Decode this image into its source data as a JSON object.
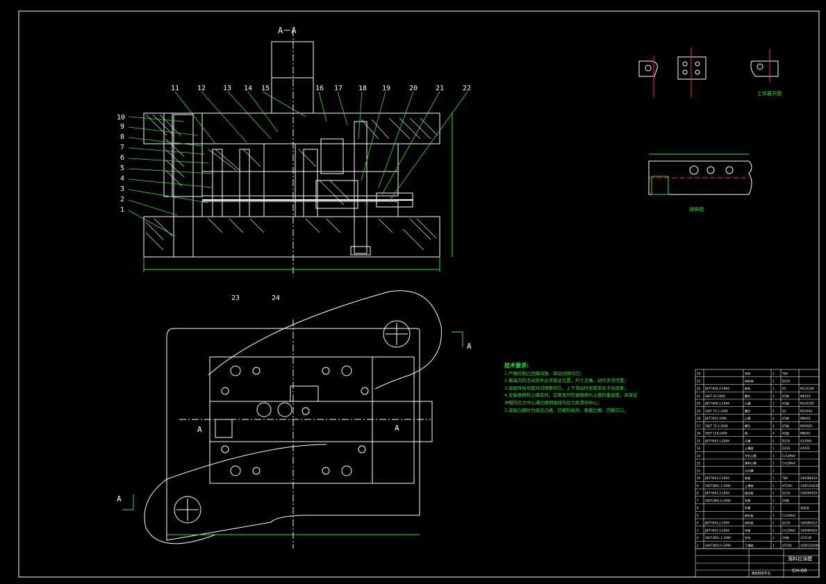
{
  "colors": {
    "background": "#000000",
    "outline": "#ffffff",
    "annotation": "#2ee82e",
    "dimension": "#2ee82e",
    "center_line": "#ff3030"
  },
  "section_label": "A－A",
  "section_marks": [
    "A",
    "A",
    "A",
    "A"
  ],
  "part_callouts": [
    "1",
    "2",
    "3",
    "4",
    "5",
    "6",
    "7",
    "8",
    "9",
    "10",
    "11",
    "12",
    "13",
    "14",
    "15",
    "16",
    "17",
    "18",
    "19",
    "20",
    "21",
    "22",
    "23",
    "24"
  ],
  "views": {
    "workpiece": "工件展开图",
    "strip_layout": "排样图"
  },
  "tech_requirements": {
    "title": "技术要求:",
    "items": [
      "1.严格控制凸凹模间隙，保证间隙均匀；",
      "2.模具内的活动部件必须保证位置，尺寸正确，动作灵活可靠；",
      "3.装配导柱导套时间隙要均匀，上下滑动时无阻滞及卡住现象；",
      "4.安装模柄和上模座时，应用角尺检查模柄与上模的垂直度，并保证",
      "  冲模的压力中心通过模柄轴线与压力机滑块中心；",
      "5.装配凸模时为保证凸模、凹模的粘剂，要磨凸模、凹模刃口。"
    ]
  },
  "bom": {
    "rows": [
      {
        "no": "24",
        "code": "",
        "name": "导料",
        "qty": "2",
        "mat": "T8A",
        "note": ""
      },
      {
        "no": "23",
        "code": "",
        "name": "挡料销",
        "qty": "1",
        "mat": "Q235",
        "note": ""
      },
      {
        "no": "22",
        "code": "JB/T7646.2-1994",
        "name": "卸料",
        "qty": "1",
        "mat": "45",
        "note": "M12X100"
      },
      {
        "no": "21",
        "code": "GB/T 65-2000",
        "name": "螺钉",
        "qty": "2",
        "mat": "45钢",
        "note": "M6X10"
      },
      {
        "no": "20",
        "code": "JB/T7646.5-1994",
        "name": "凸模",
        "qty": "1",
        "mat": "45钢",
        "note": "M10X100"
      },
      {
        "no": "19",
        "code": "GB/T 70.1-2000",
        "name": "螺钉",
        "qty": "4",
        "mat": "45",
        "note": "M10X45"
      },
      {
        "no": "18",
        "code": "JB/T7652-1994",
        "name": "凸模",
        "qty": "4",
        "mat": "45钢",
        "note": "M8X45"
      },
      {
        "no": "17",
        "code": "GB/T 70.1-2000",
        "name": "螺钉",
        "qty": "4",
        "mat": "45钢",
        "note": "M10X45"
      },
      {
        "no": "16",
        "code": "GB/T 119-2000",
        "name": "销",
        "qty": "4",
        "mat": "45钢",
        "note": "M8X45"
      },
      {
        "no": "15",
        "code": "JB/T7643.1-1994",
        "name": "凸模",
        "qty": "2",
        "mat": "Q235",
        "note": "A10X60"
      },
      {
        "no": "14",
        "code": "",
        "name": "上模座",
        "qty": "1",
        "mat": "Q235",
        "note": "40X20"
      },
      {
        "no": "13",
        "code": "",
        "name": "冲孔凸模",
        "qty": "3",
        "mat": "Cr12MoV",
        "note": ""
      },
      {
        "no": "12",
        "code": "",
        "name": "落料凸模",
        "qty": "1",
        "mat": "Cr12MoV",
        "note": ""
      },
      {
        "no": "11",
        "code": "",
        "name": "凸凹模",
        "qty": "1",
        "mat": "",
        "note": ""
      },
      {
        "no": "10",
        "code": "JB/T7643.2-1994",
        "name": "垫板",
        "qty": "1",
        "mat": "T8A",
        "note": "140X80X10"
      },
      {
        "no": "9",
        "code": "GB/T2861.1-1990",
        "name": "上模座",
        "qty": "1",
        "mat": "HT200",
        "note": "140X120X35"
      },
      {
        "no": "8",
        "code": "JB/T7643.3-1994",
        "name": "固定板",
        "qty": "1",
        "mat": "Q235",
        "note": "140X80X20"
      },
      {
        "no": "7",
        "code": "GB/T2861.6-1990",
        "name": "导套",
        "qty": "2",
        "mat": "20钢",
        "note": ""
      },
      {
        "no": "6",
        "code": "",
        "name": "凹模",
        "qty": "1",
        "mat": "",
        "note": "导料块"
      },
      {
        "no": "5",
        "code": "",
        "name": "卸料板",
        "qty": "1",
        "mat": "Cr12MoV",
        "note": ""
      },
      {
        "no": "4",
        "code": "JB/T7643.2-1994",
        "name": "承料板",
        "qty": "1",
        "mat": "Q235",
        "note": "140X80X12"
      },
      {
        "no": "3",
        "code": "JB/T7643.3-1994",
        "name": "导板",
        "qty": "1",
        "mat": "Cr12MoV",
        "note": "140X80X20"
      },
      {
        "no": "2",
        "code": "GB/T2861.1-1990",
        "name": "导柱",
        "qty": "2",
        "mat": "20钢",
        "note": "22X130"
      },
      {
        "no": "1",
        "code": "GB/T2855.5-1990",
        "name": "下模座",
        "qty": "1",
        "mat": "HT200",
        "note": "140X125X40"
      }
    ],
    "header": {
      "no": "序号",
      "code": "代号",
      "name": "名称",
      "qty": "数量",
      "mat": "材料",
      "note": "备注"
    },
    "drawing_title": "落料拉深模",
    "drawing_code": "CH-00",
    "sign_labels": [
      "标记",
      "处数",
      "分区",
      "更改文件号",
      "签名",
      "年月日",
      "设计",
      "审核",
      "工艺",
      "批准"
    ],
    "stage_labels": [
      "阶段标记",
      "重量",
      "比例",
      "共 张",
      "第 张"
    ],
    "unit": "模具制造专业"
  }
}
